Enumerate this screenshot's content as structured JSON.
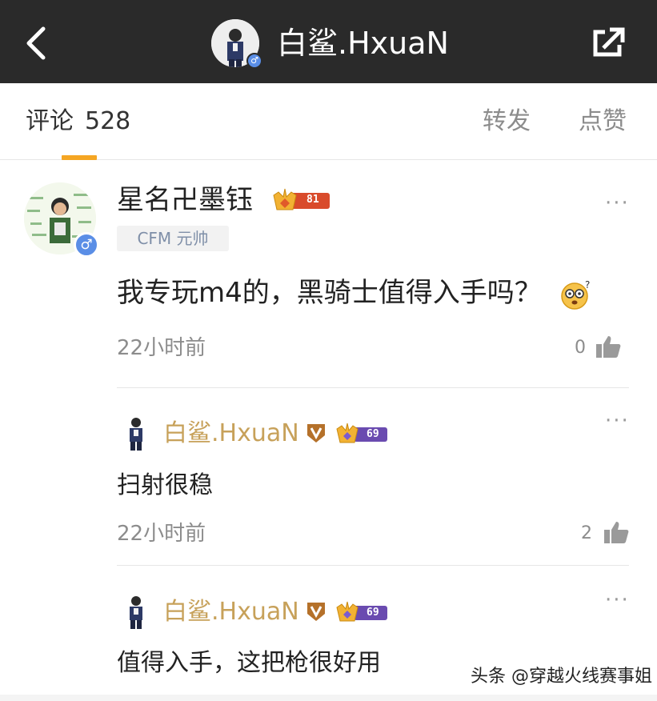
{
  "header": {
    "title": "白鲨.HxuaN",
    "back_icon": "chevron-left-icon",
    "share_icon": "external-share-icon",
    "gender_symbol": "♂"
  },
  "tabs": {
    "comments_label": "评论",
    "comments_count": "528",
    "repost_label": "转发",
    "like_label": "点赞",
    "active_color": "#f5a623"
  },
  "comment": {
    "username": "星名卍墨钰",
    "level": "81",
    "tag": "CFM 元帅",
    "gender_symbol": "♂",
    "text": "我专玩m4的，黑骑士值得入手吗？",
    "time": "22小时前",
    "likes": "0",
    "more": "···"
  },
  "replies": [
    {
      "username": "白鲨.HxuaN",
      "level": "69",
      "text": "扫射很稳",
      "time": "22小时前",
      "likes": "2",
      "more": "···"
    },
    {
      "username": "白鲨.HxuaN",
      "level": "69",
      "text": "值得入手，这把枪很好用",
      "more": "···"
    }
  ],
  "watermark": "头条 @穿越火线赛事姐",
  "colors": {
    "header_bg": "#2a2a2a",
    "reply_name": "#c7a15a",
    "gender_blue": "#5a8ee6",
    "muted_text": "#8c8c8c"
  }
}
